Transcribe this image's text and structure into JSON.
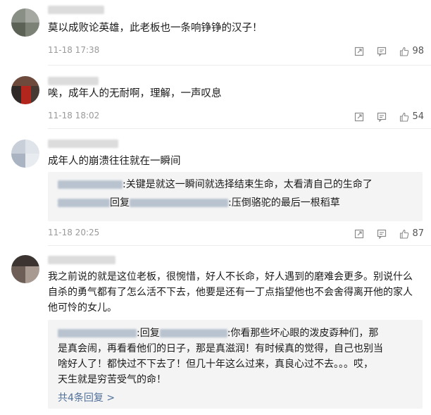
{
  "comments": [
    {
      "text": "莫以成败论英雄，此老板也一条响铮铮的汉子！",
      "time": "11-18 17:38",
      "likes": "98"
    },
    {
      "text": "唉，成年人的无耐啊，理解，一声叹息",
      "time": "11-18 18:02",
      "likes": "54"
    },
    {
      "text": "成年人的崩溃往往就在一瞬间",
      "time": "11-18 20:25",
      "likes": "87",
      "replies": [
        {
          "prefix": ":",
          "text": "关键是就这一瞬间就选择结束生命，太看清自己的生命了"
        },
        {
          "prefix": "回复",
          "text": ":压倒骆驼的最后一根稻草"
        }
      ]
    },
    {
      "text_lines": [
        "我之前说的就是这位老板，很惋惜，好人不长命，好人遇到的磨难会更多。别说什么",
        "自杀的勇气都有了怎么活不下去，他要是还有一丁点指望他也不会舍得离开他的家人",
        "他可怜的女儿。"
      ],
      "reply": {
        "prefix": ":回复",
        "lines": [
          ":你看那些坏心眼的泼皮孬种们，那",
          "是真会闹，再看看他们的日子，那是真滋润！有时候真的觉得，自己也别当",
          "啥好人了！都快过不下去了！但几十年这么过来，真良心过不去。。。哎，",
          "天生就是穷苦受气的命！"
        ]
      },
      "more_replies": "共4条回复 >"
    }
  ],
  "icons": {
    "share": "share-icon",
    "comment": "comment-icon",
    "like": "thumbs-up-icon"
  },
  "colors": {
    "link": "#50709a",
    "meta": "#9a9a9a",
    "reply_bg": "#f4f4f4"
  }
}
